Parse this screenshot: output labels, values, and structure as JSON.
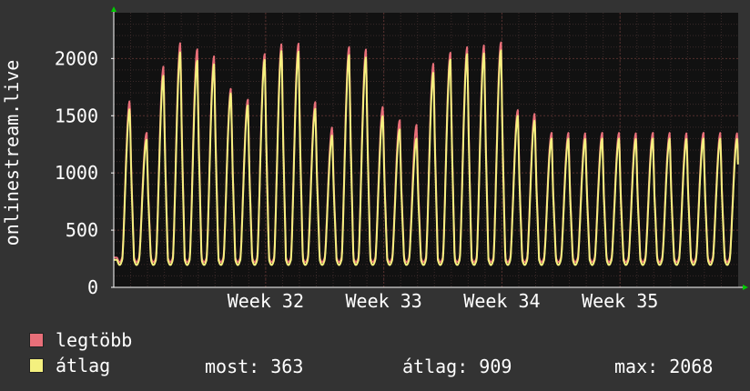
{
  "chart_data": {
    "type": "line",
    "ylabel": "onlinestream.live",
    "ylim": [
      0,
      2400
    ],
    "yticks": [
      0,
      500,
      1000,
      1500,
      2000
    ],
    "xlim": [
      0,
      37
    ],
    "xtick_labels": [
      "Week 32",
      "Week 33",
      "Week 34",
      "Week 35"
    ],
    "xtick_positions": [
      9,
      16,
      23,
      30
    ],
    "grid": true,
    "colors": {
      "background": "#333333",
      "plot": "#111111",
      "grid": "#55302e",
      "axis": "#ffffff",
      "arrow": "#00cc00",
      "max": "#e86f79",
      "avg": "#f4f07f"
    },
    "daily_peaks_max": [
      1630,
      1350,
      1930,
      2140,
      2080,
      2020,
      1740,
      1640,
      2040,
      2130,
      2130,
      1620,
      1400,
      2100,
      2080,
      1580,
      1460,
      1420,
      1960,
      2050,
      2100,
      2120,
      2140,
      1550,
      1520,
      1350
    ],
    "daily_peaks_avg": [
      1560,
      1290,
      1850,
      2060,
      1980,
      1950,
      1700,
      1590,
      1990,
      2070,
      2060,
      1560,
      1330,
      2030,
      2010,
      1500,
      1380,
      1300,
      1880,
      1990,
      2040,
      2050,
      2070,
      1500,
      1460,
      1300
    ],
    "series": [
      {
        "name": "legtöbb",
        "color": "#e86f79"
      },
      {
        "name": "átlag",
        "color": "#f4f07f"
      }
    ]
  },
  "legend": {
    "max_label": "legtöbb",
    "avg_label": "átlag"
  },
  "stats": {
    "now": "most: 363",
    "avg": "átlag: 909",
    "max": "max: 2068"
  }
}
